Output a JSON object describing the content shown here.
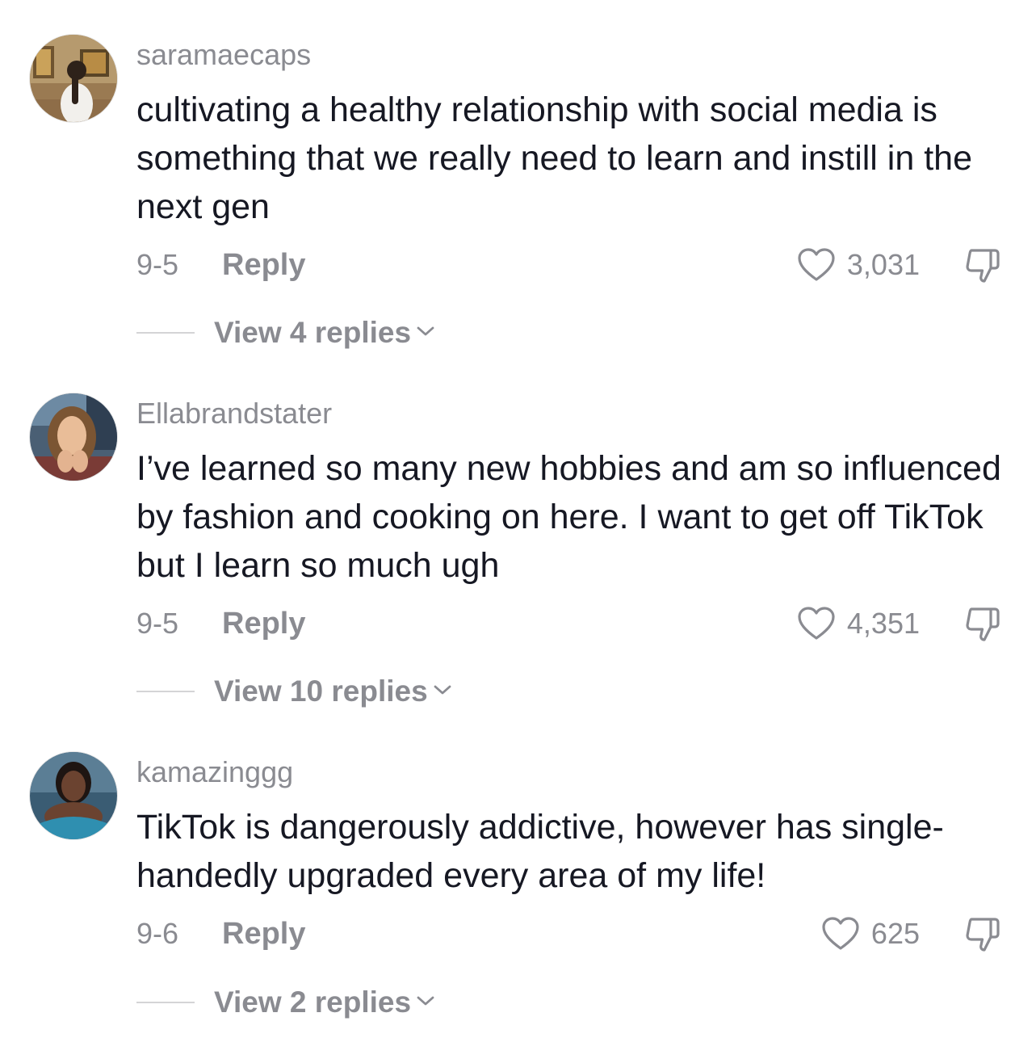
{
  "comments": [
    {
      "username": "saramaecaps",
      "text": "cultivating a healthy relationship with social media is something that we really need to learn and instill in the next gen",
      "date": "9-5",
      "reply_label": "Reply",
      "likes": "3,031",
      "view_replies": "View 4 replies"
    },
    {
      "username": "Ellabrandstater",
      "text": "I’ve learned so many new hobbies and am so influenced by fashion and cooking on here. I want to get off TikTok but I learn so much ugh",
      "date": "9-5",
      "reply_label": "Reply",
      "likes": "4,351",
      "view_replies": "View 10 replies"
    },
    {
      "username": "kamazinggg",
      "text": "TikTok is dangerously addictive, however has single-handedly upgraded every area of my life!",
      "date": "9-6",
      "reply_label": "Reply",
      "likes": "625",
      "view_replies": "View 2 replies"
    }
  ],
  "icons": {
    "like": "heart-outline-icon",
    "dislike": "thumbs-down-icon",
    "expand": "chevron-down-icon"
  },
  "colors": {
    "text_primary": "#161823",
    "text_secondary": "#8a8b91",
    "divider": "#d4d4d6",
    "background": "#ffffff"
  }
}
